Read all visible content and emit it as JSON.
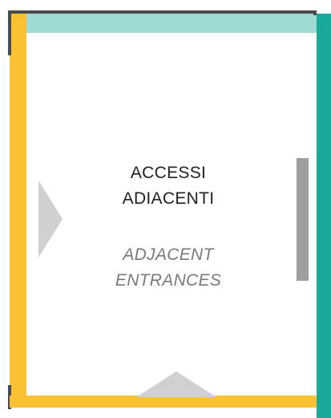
{
  "labels": {
    "italian_line1": "ACCESSI",
    "italian_line2": "ADIACENTI",
    "english_line1": "ADJACENT",
    "english_line2": "ENTRANCES"
  },
  "colors": {
    "wall_yellow": "#fac135",
    "wall_teal": "#1aaa99",
    "band_light_teal": "#9fdbd3",
    "edge_dark": "#4b4b4d",
    "entrance_bar_grey": "#9d9ea0",
    "arrow_grey": "#cfd0d2"
  }
}
